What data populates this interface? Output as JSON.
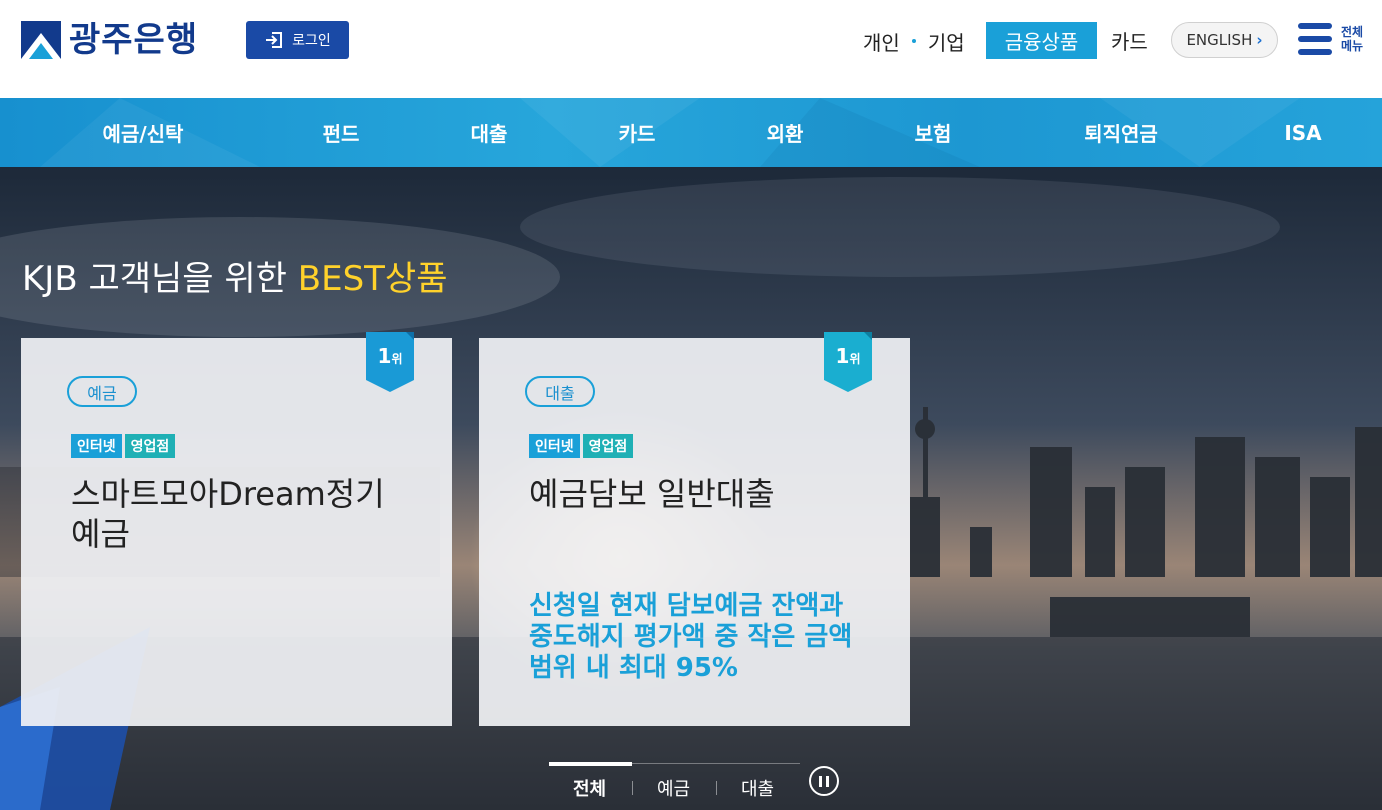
{
  "header": {
    "logo_text": "광주은행",
    "login_label": "로그인",
    "personal_label": "개인",
    "corporate_label": "기업",
    "financial_products_label": "금융상품",
    "card_label": "카드",
    "english_label": "ENGLISH",
    "allmenu_line1": "전체",
    "allmenu_line2": "메뉴"
  },
  "gnb": {
    "items": [
      {
        "label": "예금/신탁"
      },
      {
        "label": "펀드"
      },
      {
        "label": "대출"
      },
      {
        "label": "카드"
      },
      {
        "label": "외환"
      },
      {
        "label": "보험"
      },
      {
        "label": "퇴직연금"
      },
      {
        "label": "ISA"
      }
    ]
  },
  "hero": {
    "title_prefix": "KJB 고객님을 위한 ",
    "title_highlight": "BEST상품",
    "cards": [
      {
        "rank": "1",
        "rank_suffix": "위",
        "category": "예금",
        "tags": [
          "인터넷",
          "영업점"
        ],
        "name": "스마트모아Dream정기예금",
        "description": ""
      },
      {
        "rank": "1",
        "rank_suffix": "위",
        "category": "대출",
        "tags": [
          "인터넷",
          "영업점"
        ],
        "name": "예금담보 일반대출",
        "description": "신청일 현재 담보예금 잔액과 중도해지 평가액 중 작은 금액 범위 내 최대 95%"
      }
    ],
    "tabs": [
      {
        "label": "전체",
        "active": true
      },
      {
        "label": "예금",
        "active": false
      },
      {
        "label": "대출",
        "active": false
      }
    ]
  },
  "colors": {
    "brand_navy": "#123a8c",
    "accent_blue": "#1aa0d8",
    "highlight_yellow": "#ffd22b"
  }
}
